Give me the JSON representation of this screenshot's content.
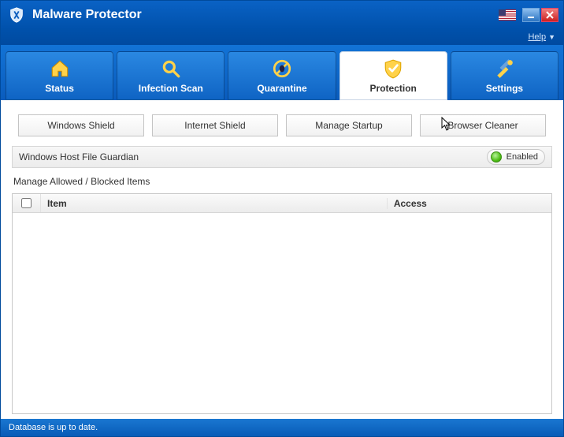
{
  "app_title": "Malware Protector",
  "help_label": "Help",
  "nav": [
    {
      "key": "status",
      "label": "Status",
      "icon": "home-icon"
    },
    {
      "key": "infection",
      "label": "Infection Scan",
      "icon": "search-icon"
    },
    {
      "key": "quarantine",
      "label": "Quarantine",
      "icon": "bug-ban-icon"
    },
    {
      "key": "protection",
      "label": "Protection",
      "icon": "shield-icon",
      "active": true
    },
    {
      "key": "settings",
      "label": "Settings",
      "icon": "tools-icon"
    }
  ],
  "subtabs": [
    "Windows Shield",
    "Internet Shield",
    "Manage Startup",
    "Browser Cleaner"
  ],
  "guardian": {
    "label": "Windows Host File Guardian",
    "toggle_state": "Enabled"
  },
  "manage_label": "Manage Allowed / Blocked Items",
  "table": {
    "columns": {
      "item": "Item",
      "access": "Access"
    },
    "rows": []
  },
  "status_text": "Database is up to date.",
  "colors": {
    "brand_blue": "#0a5cbd",
    "green": "#4fbf16"
  }
}
